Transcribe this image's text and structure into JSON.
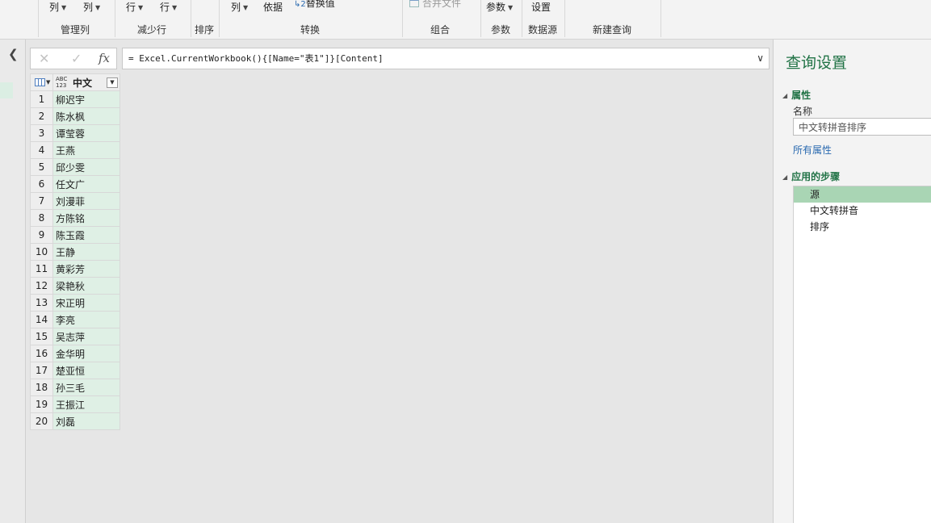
{
  "ribbon": {
    "buttons": {
      "col1": "列",
      "col2": "列",
      "row1": "行",
      "row2": "行",
      "col3": "列",
      "by": "依据",
      "replace": "替换值",
      "replace_prefix": "↳2",
      "combine_files": "合并文件",
      "params": "参数",
      "settings": "设置"
    },
    "groups": {
      "manage_cols": "管理列",
      "reduce_rows": "减少行",
      "sort": "排序",
      "transform": "转换",
      "combine": "组合",
      "parameters": "参数",
      "data_source": "数据源",
      "new_query": "新建查询"
    }
  },
  "formula": {
    "text": "= Excel.CurrentWorkbook(){[Name=\"表1\"]}[Content]"
  },
  "grid": {
    "column_header": "中文",
    "type_icon_top": "ABC",
    "type_icon_bottom": "123",
    "rows": [
      {
        "n": "1",
        "v": "柳迟宇"
      },
      {
        "n": "2",
        "v": "陈水枫"
      },
      {
        "n": "3",
        "v": "谭莹蓉"
      },
      {
        "n": "4",
        "v": "王燕"
      },
      {
        "n": "5",
        "v": "邱少雯"
      },
      {
        "n": "6",
        "v": "任文广"
      },
      {
        "n": "7",
        "v": "刘漫菲"
      },
      {
        "n": "8",
        "v": "方陈铭"
      },
      {
        "n": "9",
        "v": "陈玉霞"
      },
      {
        "n": "10",
        "v": "王静"
      },
      {
        "n": "11",
        "v": "黄彩芳"
      },
      {
        "n": "12",
        "v": "梁艳秋"
      },
      {
        "n": "13",
        "v": "宋正明"
      },
      {
        "n": "14",
        "v": "李亮"
      },
      {
        "n": "15",
        "v": "吴志萍"
      },
      {
        "n": "16",
        "v": "金华明"
      },
      {
        "n": "17",
        "v": "楚亚恒"
      },
      {
        "n": "18",
        "v": "孙三毛"
      },
      {
        "n": "19",
        "v": "王振江"
      },
      {
        "n": "20",
        "v": "刘磊"
      }
    ]
  },
  "query_settings": {
    "title": "查询设置",
    "properties_header": "属性",
    "name_label": "名称",
    "name_value": "中文转拼音排序",
    "all_properties_link": "所有属性",
    "applied_steps_header": "应用的步骤",
    "steps": [
      "源",
      "中文转拼音",
      "排序"
    ]
  }
}
